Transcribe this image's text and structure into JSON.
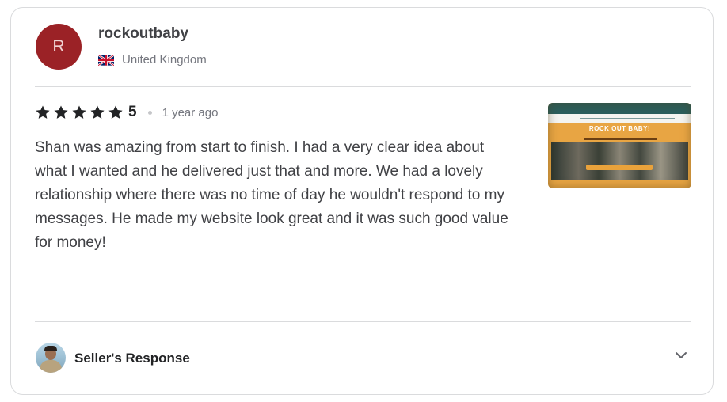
{
  "reviewer": {
    "avatar_initial": "R",
    "avatar_color": "#9b2226",
    "username": "rockoutbaby",
    "country": "United Kingdom",
    "country_flag_icon": "uk-flag-icon"
  },
  "review": {
    "rating": "5",
    "rating_max": 5,
    "star_icon": "star-icon",
    "time_ago": "1 year ago",
    "text": "Shan was amazing from start to finish. I had a very clear idea about what I wanted and he delivered just that and more. We had a lovely relationship where there was no time of day he wouldn't respond to my messages. He made my website look great and it was such good value for money!",
    "thumbnail": {
      "headline": "ROCK OUT BABY!"
    }
  },
  "seller_response": {
    "label": "Seller's Response",
    "toggle_icon": "chevron-down-icon"
  },
  "colors": {
    "text_primary": "#404145",
    "text_secondary": "#74767e",
    "border": "#dadbdd",
    "star": "#222325"
  }
}
